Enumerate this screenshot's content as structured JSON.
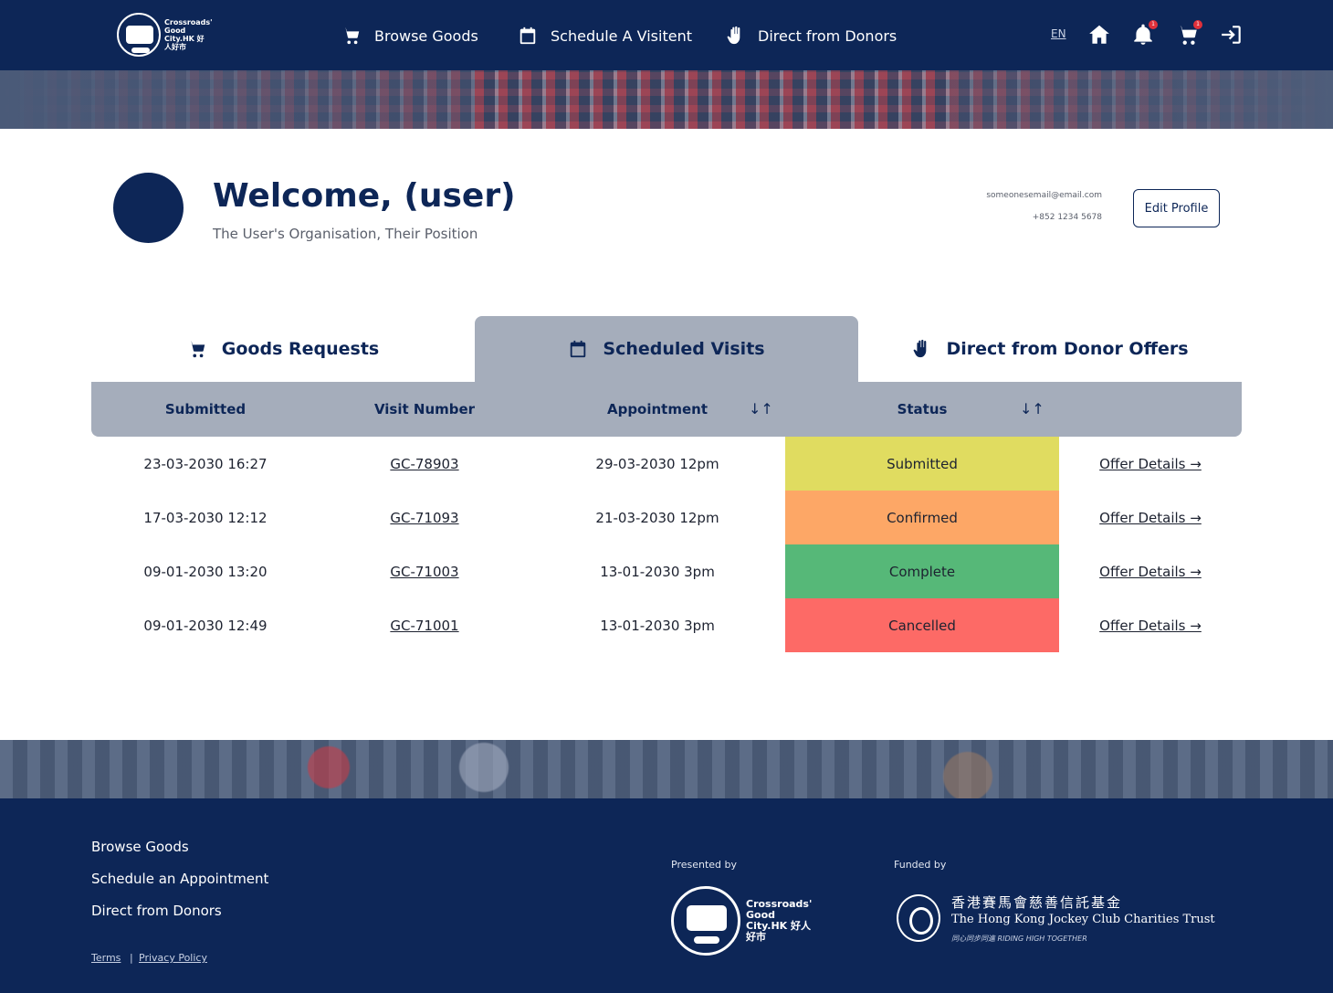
{
  "nav": {
    "logo_text": "Crossroads' Good City.HK 好人好市",
    "items": [
      {
        "label": "Browse Goods",
        "icon": "cart-icon"
      },
      {
        "label": "Schedule A Visitent",
        "icon": "calendar-icon"
      },
      {
        "label": "Direct from Donors",
        "icon": "hand-icon"
      }
    ],
    "lang": "EN",
    "notifications_count": "1",
    "cart_count": "1"
  },
  "profile": {
    "welcome": "Welcome, (user)",
    "organisation": "The User's Organisation, Their Position",
    "email": "someonesemail@email.com",
    "phone": "+852 1234 5678",
    "edit_label": "Edit Profile"
  },
  "tabs": [
    {
      "label": "Goods Requests",
      "icon": "cart-icon",
      "active": false
    },
    {
      "label": "Scheduled Visits",
      "icon": "calendar-icon",
      "active": true
    },
    {
      "label": "Direct from Donor Offers",
      "icon": "hand-icon",
      "active": false
    }
  ],
  "table": {
    "columns": [
      "Submitted",
      "Visit Number",
      "Appointment",
      "Status"
    ],
    "sort_glyph": "↓↑",
    "rows": [
      {
        "submitted": "23-03-2030 16:27",
        "visit": "GC-78903",
        "appointment": "29-03-2030 12pm",
        "status": "Submitted",
        "status_color": "#e0dc60",
        "action": "Offer Details →"
      },
      {
        "submitted": "17-03-2030 12:12",
        "visit": "GC-71093",
        "appointment": "21-03-2030 12pm",
        "status": "Confirmed",
        "status_color": "#fda766",
        "action": "Offer Details →"
      },
      {
        "submitted": "09-01-2030 13:20",
        "visit": "GC-71003",
        "appointment": "13-01-2030 3pm",
        "status": "Complete",
        "status_color": "#56b878",
        "action": "Offer Details →"
      },
      {
        "submitted": "09-01-2030 12:49",
        "visit": "GC-71001",
        "appointment": "13-01-2030 3pm",
        "status": "Cancelled",
        "status_color": "#fd6a66",
        "action": "Offer Details →"
      }
    ]
  },
  "footer": {
    "links": [
      "Browse Goods",
      "Schedule an Appointment",
      "Direct from Donors"
    ],
    "terms": "Terms",
    "privacy": "Privacy Policy",
    "separator": "|",
    "presented_by": "Presented by",
    "funded_by": "Funded by",
    "presenter_logo_text": "Crossroads' Good City.HK 好人好市",
    "funder_chinese": "香港賽馬會慈善信託基金",
    "funder_english": "The Hong Kong Jockey Club Charities Trust",
    "funder_tagline": "同心同步同進 RIDING HIGH TOGETHER"
  },
  "colors": {
    "navy": "#0d2657",
    "header_gray": "#a5adbb"
  }
}
